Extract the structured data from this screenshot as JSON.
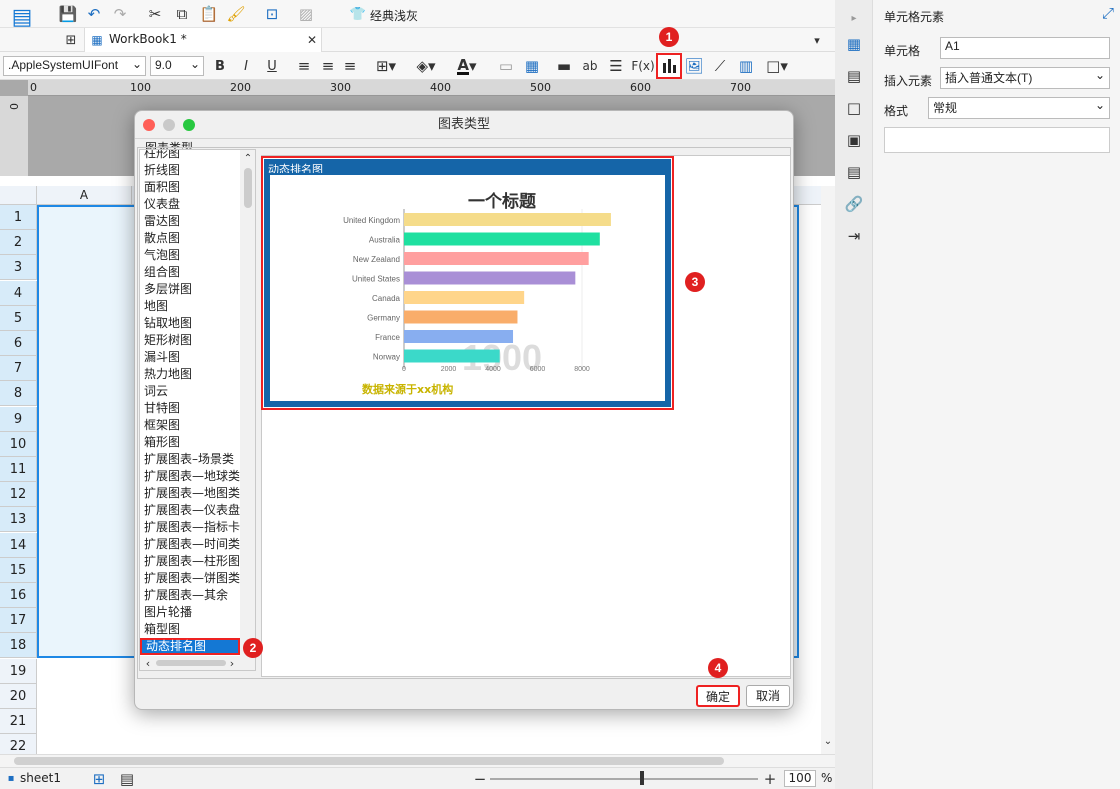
{
  "toolbar": {
    "theme_label": "经典浅灰"
  },
  "tabs": [
    {
      "label": "WorkBook1 *"
    }
  ],
  "format": {
    "font": ".AppleSystemUIFont",
    "size": "9.0"
  },
  "ruler": {
    "ticks": [
      "0",
      "100",
      "200",
      "300",
      "400",
      "500",
      "600",
      "700"
    ],
    "vlabel": "0"
  },
  "sheet": {
    "col_a": "A",
    "rows": [
      "1",
      "2",
      "3",
      "4",
      "5",
      "6",
      "7",
      "8",
      "9",
      "10",
      "11",
      "12",
      "13",
      "14",
      "15",
      "16",
      "17",
      "18",
      "19",
      "20",
      "21",
      "22"
    ]
  },
  "status": {
    "sheet_tab": "sheet1",
    "zoom": "100",
    "percent": "%"
  },
  "right_panel": {
    "title": "单元格元素",
    "cell_label": "单元格",
    "cell_value": "A1",
    "insert_label": "插入元素",
    "insert_value": "插入普通文本(T)",
    "style_label": "格式",
    "style_value": "常规"
  },
  "dialog": {
    "title": "图表类型",
    "group_label": "图表类型",
    "types": [
      "柱形图",
      "折线图",
      "面积图",
      "仪表盘",
      "雷达图",
      "散点图",
      "气泡图",
      "组合图",
      "多层饼图",
      "地图",
      "钻取地图",
      "矩形树图",
      "漏斗图",
      "热力地图",
      "词云",
      "甘特图",
      "框架图",
      "箱形图",
      "扩展图表–场景类",
      "扩展图表—地球类",
      "扩展图表—地图类",
      "扩展图表—仪表盘",
      "扩展图表—指标卡",
      "扩展图表—时间类",
      "扩展图表—柱形图",
      "扩展图表—饼图类",
      "扩展图表—其余",
      "图片轮播",
      "箱型图",
      "动态排名图"
    ],
    "selected_type": "动态排名图",
    "preview_label": "动态排名图",
    "ok_label": "确定",
    "cancel_label": "取消"
  },
  "badges": [
    "1",
    "2",
    "3",
    "4"
  ],
  "chart_data": {
    "type": "bar",
    "title": "一个标题",
    "categories": [
      "United Kingdom",
      "Australia",
      "New Zealand",
      "United States",
      "Canada",
      "Germany",
      "France",
      "Norway"
    ],
    "values": [
      9300,
      8800,
      8300,
      7700,
      5400,
      5100,
      4900,
      4300
    ],
    "colors": [
      "#f5dc8a",
      "#1fe0a0",
      "#ff9f9f",
      "#a98fd6",
      "#ffd58a",
      "#f9ad6a",
      "#88aef0",
      "#3bd9c9"
    ],
    "xticks": [
      "0",
      "2000",
      "4000",
      "6000",
      "8000"
    ],
    "xlim": [
      0,
      8000
    ],
    "watermark": "1900",
    "source": "数据来源于xx机构"
  }
}
